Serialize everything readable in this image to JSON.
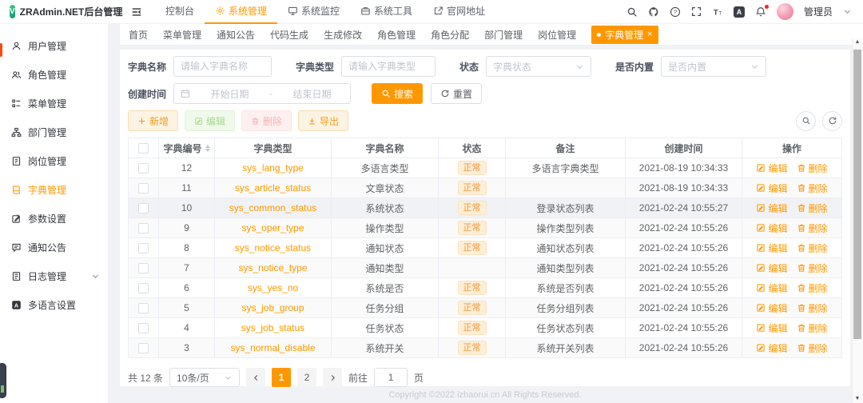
{
  "colors": {
    "accent": "#ff9800"
  },
  "app": {
    "title": "ZRAdmin.NET后台管理",
    "logo_letter": "V"
  },
  "topnav": {
    "items": [
      {
        "label": "控制台",
        "icon": "",
        "active": false
      },
      {
        "label": "系统管理",
        "icon": "gear-icon",
        "active": true
      },
      {
        "label": "系统监控",
        "icon": "monitor-icon",
        "active": false
      },
      {
        "label": "系统工具",
        "icon": "toolbox-icon",
        "active": false
      },
      {
        "label": "官网地址",
        "icon": "external-link-icon",
        "active": false
      }
    ]
  },
  "header": {
    "user_name": "管理员"
  },
  "sidebar": {
    "items": [
      {
        "label": "用户管理",
        "icon": "user-icon",
        "active": false,
        "expandable": false
      },
      {
        "label": "角色管理",
        "icon": "role-icon",
        "active": false,
        "expandable": false
      },
      {
        "label": "菜单管理",
        "icon": "menu-icon",
        "active": false,
        "expandable": false
      },
      {
        "label": "部门管理",
        "icon": "dept-icon",
        "active": false,
        "expandable": false
      },
      {
        "label": "岗位管理",
        "icon": "post-icon",
        "active": false,
        "expandable": false
      },
      {
        "label": "字典管理",
        "icon": "dict-icon",
        "active": true,
        "expandable": false
      },
      {
        "label": "参数设置",
        "icon": "param-icon",
        "active": false,
        "expandable": false
      },
      {
        "label": "通知公告",
        "icon": "notice-icon",
        "active": false,
        "expandable": false
      },
      {
        "label": "日志管理",
        "icon": "log-icon",
        "active": false,
        "expandable": true
      },
      {
        "label": "多语言设置",
        "icon": "language-icon",
        "active": false,
        "expandable": false
      }
    ]
  },
  "tabs": {
    "items": [
      "首页",
      "菜单管理",
      "通知公告",
      "代码生成",
      "生成修改",
      "角色管理",
      "角色分配",
      "部门管理",
      "岗位管理",
      "字典管理"
    ],
    "active": "字典管理"
  },
  "filters": {
    "dict_name_label": "字典名称",
    "dict_name_placeholder": "请输入字典名称",
    "dict_type_label": "字典类型",
    "dict_type_placeholder": "请输入字典类型",
    "status_label": "状态",
    "status_placeholder": "字典状态",
    "builtin_label": "是否内置",
    "builtin_placeholder": "是否内置",
    "create_time_label": "创建时间",
    "date_start_placeholder": "开始日期",
    "date_separator": "-",
    "date_end_placeholder": "结束日期",
    "search_label": "搜索",
    "reset_label": "重置"
  },
  "toolbar": {
    "add": "新增",
    "edit": "编辑",
    "delete": "删除",
    "export": "导出"
  },
  "table": {
    "columns": [
      "字典编号",
      "字典类型",
      "字典名称",
      "状态",
      "备注",
      "创建时间",
      "操作"
    ],
    "edit_label": "编辑",
    "delete_label": "删除",
    "rows": [
      {
        "id": "12",
        "type": "sys_lang_type",
        "name": "多语言类型",
        "status": "正常",
        "remark": "多语言字典类型",
        "created": "2021-08-19 10:34:33"
      },
      {
        "id": "11",
        "type": "sys_article_status",
        "name": "文章状态",
        "status": "正常",
        "remark": "",
        "created": "2021-08-19 10:34:33"
      },
      {
        "id": "10",
        "type": "sys_common_status",
        "name": "系统状态",
        "status": "正常",
        "remark": "登录状态列表",
        "created": "2021-02-24 10:55:27"
      },
      {
        "id": "9",
        "type": "sys_oper_type",
        "name": "操作类型",
        "status": "正常",
        "remark": "操作类型列表",
        "created": "2021-02-24 10:55:26"
      },
      {
        "id": "8",
        "type": "sys_notice_status",
        "name": "通知状态",
        "status": "正常",
        "remark": "通知状态列表",
        "created": "2021-02-24 10:55:26"
      },
      {
        "id": "7",
        "type": "sys_notice_type",
        "name": "通知类型",
        "status": "",
        "remark": "通知类型列表",
        "created": "2021-02-24 10:55:26"
      },
      {
        "id": "6",
        "type": "sys_yes_no",
        "name": "系统是否",
        "status": "正常",
        "remark": "系统是否列表",
        "created": "2021-02-24 10:55:26"
      },
      {
        "id": "5",
        "type": "sys_job_group",
        "name": "任务分组",
        "status": "正常",
        "remark": "任务分组列表",
        "created": "2021-02-24 10:55:26"
      },
      {
        "id": "4",
        "type": "sys_job_status",
        "name": "任务状态",
        "status": "正常",
        "remark": "任务状态列表",
        "created": "2021-02-24 10:55:26"
      },
      {
        "id": "3",
        "type": "sys_normal_disable",
        "name": "系统开关",
        "status": "正常",
        "remark": "系统开关列表",
        "created": "2021-02-24 10:55:26"
      }
    ]
  },
  "pagination": {
    "total_text": "共 12 条",
    "page_size": "10条/页",
    "pages": [
      "1",
      "2"
    ],
    "active_page": "1",
    "goto_label": "前往",
    "goto_value": "1",
    "goto_suffix": "页"
  },
  "footer": {
    "copyright": "Copyright ©2022 izhaorui.cn All Rights Reserved."
  }
}
